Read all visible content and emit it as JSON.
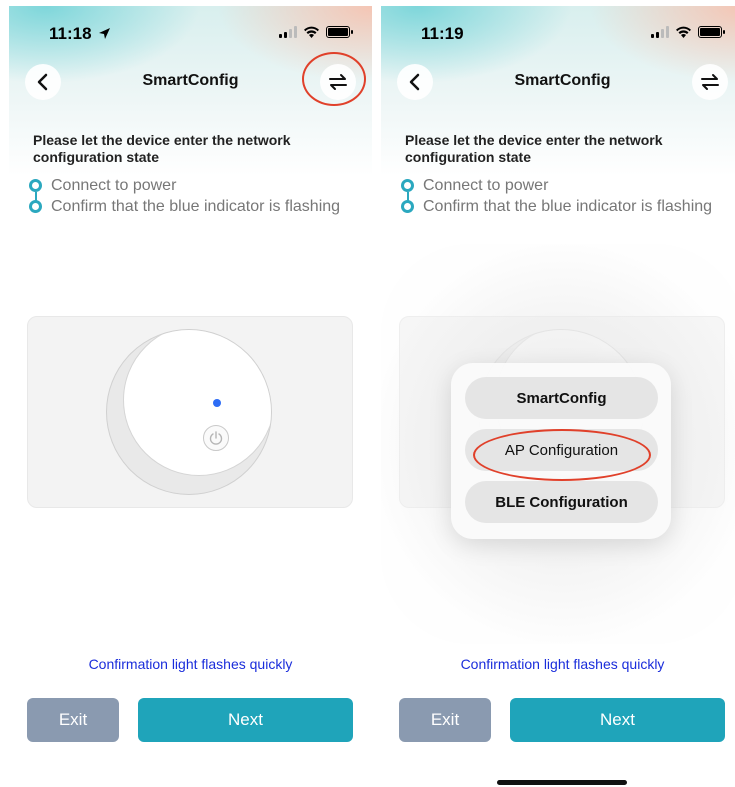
{
  "left_screen": {
    "status": {
      "time": "11:18"
    },
    "header": {
      "title": "SmartConfig",
      "back_icon": "chevron-left-icon",
      "switch_icon": "swap-arrows-icon"
    },
    "instruction": "Please let the device enter the network configuration state",
    "steps": [
      "Connect to power",
      "Confirm that the blue indicator is flashing"
    ],
    "confirm_link": "Confirmation light flashes quickly",
    "buttons": {
      "exit": "Exit",
      "next": "Next"
    }
  },
  "right_screen": {
    "status": {
      "time": "11:19"
    },
    "header": {
      "title": "SmartConfig",
      "back_icon": "chevron-left-icon",
      "switch_icon": "swap-arrows-icon"
    },
    "instruction": "Please let the device enter the network configuration state",
    "steps": [
      "Connect to power",
      "Confirm that the blue indicator is flashing"
    ],
    "menu": [
      "SmartConfig",
      "AP Configuration",
      "BLE Configuration"
    ],
    "confirm_link": "Confirmation light flashes quickly",
    "buttons": {
      "exit": "Exit",
      "next": "Next"
    }
  },
  "colors": {
    "accent": "#1fa4ba",
    "exit_button": "#8a9ab0",
    "link": "#1a2ddb",
    "indicator": "#2d6cf5",
    "annotation": "#e0402a"
  }
}
